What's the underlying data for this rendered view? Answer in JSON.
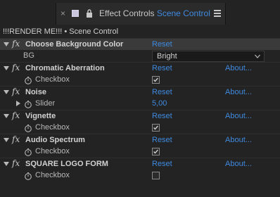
{
  "tab": {
    "title": "Effect Controls",
    "layer": "Scene Control"
  },
  "breadcrumb": "!!!RENDER ME!!! • Scene Control",
  "effects": [
    {
      "name": "Choose Background Color",
      "reset": "Reset",
      "param": {
        "label": "BG",
        "type": "dropdown",
        "value": "Bright"
      }
    },
    {
      "name": "Chromatic Aberration",
      "reset": "Reset",
      "about": "About...",
      "param": {
        "label": "Checkbox",
        "type": "checkbox",
        "checked": true
      }
    },
    {
      "name": "Noise",
      "reset": "Reset",
      "about": "About...",
      "param": {
        "label": "Slider",
        "type": "slider",
        "value": "5,00"
      }
    },
    {
      "name": "Vignette",
      "reset": "Reset",
      "about": "About...",
      "param": {
        "label": "Checkbox",
        "type": "checkbox",
        "checked": true
      }
    },
    {
      "name": "Audio Spectrum",
      "reset": "Reset",
      "about": "About...",
      "param": {
        "label": "Checkbox",
        "type": "checkbox",
        "checked": true
      }
    },
    {
      "name": "SQUARE LOGO FORM",
      "reset": "Reset",
      "about": "About...",
      "param": {
        "label": "Checkbox",
        "type": "checkbox",
        "checked": false
      }
    }
  ],
  "colors": {
    "accent": "#3f8ae0",
    "panel": "#232323",
    "selected_row": "#3a3a3a"
  },
  "icons": {
    "close": "close-icon",
    "lock": "lock-icon",
    "menu": "menu-icon",
    "twirl": "twirl-down-icon",
    "stopwatch": "stopwatch-icon",
    "fx": "fx-icon"
  }
}
